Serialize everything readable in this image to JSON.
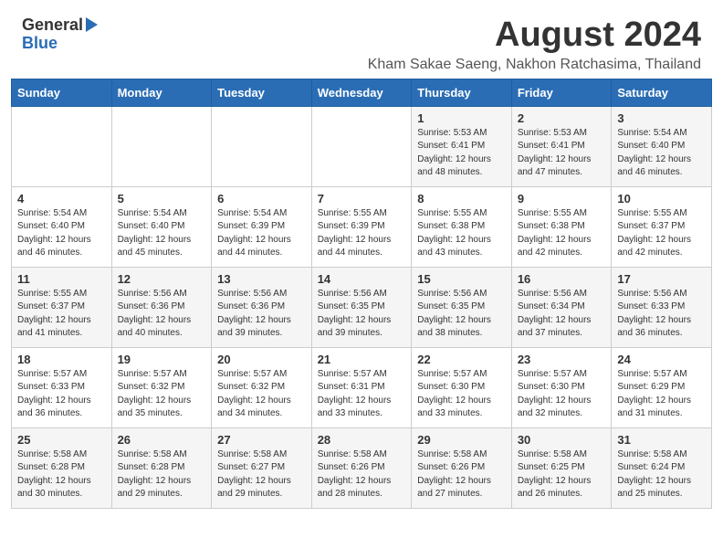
{
  "header": {
    "logo_general": "General",
    "logo_blue": "Blue",
    "main_title": "August 2024",
    "subtitle": "Kham Sakae Saeng, Nakhon Ratchasima, Thailand"
  },
  "calendar": {
    "days_of_week": [
      "Sunday",
      "Monday",
      "Tuesday",
      "Wednesday",
      "Thursday",
      "Friday",
      "Saturday"
    ],
    "weeks": [
      [
        {
          "day": "",
          "info": ""
        },
        {
          "day": "",
          "info": ""
        },
        {
          "day": "",
          "info": ""
        },
        {
          "day": "",
          "info": ""
        },
        {
          "day": "1",
          "info": "Sunrise: 5:53 AM\nSunset: 6:41 PM\nDaylight: 12 hours\nand 48 minutes."
        },
        {
          "day": "2",
          "info": "Sunrise: 5:53 AM\nSunset: 6:41 PM\nDaylight: 12 hours\nand 47 minutes."
        },
        {
          "day": "3",
          "info": "Sunrise: 5:54 AM\nSunset: 6:40 PM\nDaylight: 12 hours\nand 46 minutes."
        }
      ],
      [
        {
          "day": "4",
          "info": "Sunrise: 5:54 AM\nSunset: 6:40 PM\nDaylight: 12 hours\nand 46 minutes."
        },
        {
          "day": "5",
          "info": "Sunrise: 5:54 AM\nSunset: 6:40 PM\nDaylight: 12 hours\nand 45 minutes."
        },
        {
          "day": "6",
          "info": "Sunrise: 5:54 AM\nSunset: 6:39 PM\nDaylight: 12 hours\nand 44 minutes."
        },
        {
          "day": "7",
          "info": "Sunrise: 5:55 AM\nSunset: 6:39 PM\nDaylight: 12 hours\nand 44 minutes."
        },
        {
          "day": "8",
          "info": "Sunrise: 5:55 AM\nSunset: 6:38 PM\nDaylight: 12 hours\nand 43 minutes."
        },
        {
          "day": "9",
          "info": "Sunrise: 5:55 AM\nSunset: 6:38 PM\nDaylight: 12 hours\nand 42 minutes."
        },
        {
          "day": "10",
          "info": "Sunrise: 5:55 AM\nSunset: 6:37 PM\nDaylight: 12 hours\nand 42 minutes."
        }
      ],
      [
        {
          "day": "11",
          "info": "Sunrise: 5:55 AM\nSunset: 6:37 PM\nDaylight: 12 hours\nand 41 minutes."
        },
        {
          "day": "12",
          "info": "Sunrise: 5:56 AM\nSunset: 6:36 PM\nDaylight: 12 hours\nand 40 minutes."
        },
        {
          "day": "13",
          "info": "Sunrise: 5:56 AM\nSunset: 6:36 PM\nDaylight: 12 hours\nand 39 minutes."
        },
        {
          "day": "14",
          "info": "Sunrise: 5:56 AM\nSunset: 6:35 PM\nDaylight: 12 hours\nand 39 minutes."
        },
        {
          "day": "15",
          "info": "Sunrise: 5:56 AM\nSunset: 6:35 PM\nDaylight: 12 hours\nand 38 minutes."
        },
        {
          "day": "16",
          "info": "Sunrise: 5:56 AM\nSunset: 6:34 PM\nDaylight: 12 hours\nand 37 minutes."
        },
        {
          "day": "17",
          "info": "Sunrise: 5:56 AM\nSunset: 6:33 PM\nDaylight: 12 hours\nand 36 minutes."
        }
      ],
      [
        {
          "day": "18",
          "info": "Sunrise: 5:57 AM\nSunset: 6:33 PM\nDaylight: 12 hours\nand 36 minutes."
        },
        {
          "day": "19",
          "info": "Sunrise: 5:57 AM\nSunset: 6:32 PM\nDaylight: 12 hours\nand 35 minutes."
        },
        {
          "day": "20",
          "info": "Sunrise: 5:57 AM\nSunset: 6:32 PM\nDaylight: 12 hours\nand 34 minutes."
        },
        {
          "day": "21",
          "info": "Sunrise: 5:57 AM\nSunset: 6:31 PM\nDaylight: 12 hours\nand 33 minutes."
        },
        {
          "day": "22",
          "info": "Sunrise: 5:57 AM\nSunset: 6:30 PM\nDaylight: 12 hours\nand 33 minutes."
        },
        {
          "day": "23",
          "info": "Sunrise: 5:57 AM\nSunset: 6:30 PM\nDaylight: 12 hours\nand 32 minutes."
        },
        {
          "day": "24",
          "info": "Sunrise: 5:57 AM\nSunset: 6:29 PM\nDaylight: 12 hours\nand 31 minutes."
        }
      ],
      [
        {
          "day": "25",
          "info": "Sunrise: 5:58 AM\nSunset: 6:28 PM\nDaylight: 12 hours\nand 30 minutes."
        },
        {
          "day": "26",
          "info": "Sunrise: 5:58 AM\nSunset: 6:28 PM\nDaylight: 12 hours\nand 29 minutes."
        },
        {
          "day": "27",
          "info": "Sunrise: 5:58 AM\nSunset: 6:27 PM\nDaylight: 12 hours\nand 29 minutes."
        },
        {
          "day": "28",
          "info": "Sunrise: 5:58 AM\nSunset: 6:26 PM\nDaylight: 12 hours\nand 28 minutes."
        },
        {
          "day": "29",
          "info": "Sunrise: 5:58 AM\nSunset: 6:26 PM\nDaylight: 12 hours\nand 27 minutes."
        },
        {
          "day": "30",
          "info": "Sunrise: 5:58 AM\nSunset: 6:25 PM\nDaylight: 12 hours\nand 26 minutes."
        },
        {
          "day": "31",
          "info": "Sunrise: 5:58 AM\nSunset: 6:24 PM\nDaylight: 12 hours\nand 25 minutes."
        }
      ]
    ]
  }
}
